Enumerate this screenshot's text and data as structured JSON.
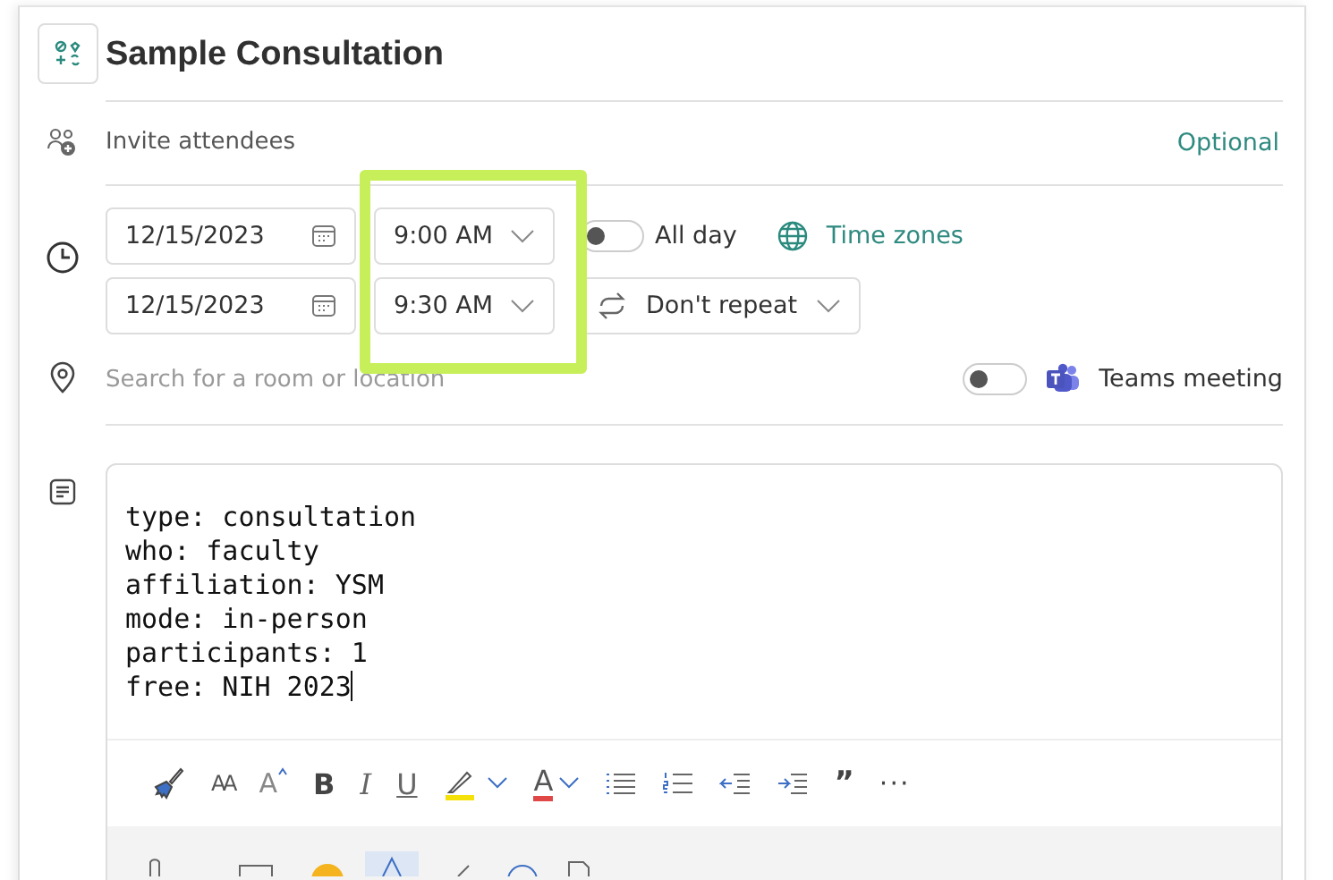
{
  "event": {
    "title": "Sample Consultation"
  },
  "attendees": {
    "placeholder": "Invite attendees",
    "optional_link": "Optional"
  },
  "start": {
    "date": "12/15/2023",
    "time": "9:00 AM"
  },
  "end": {
    "date": "12/15/2023",
    "time": "9:30 AM"
  },
  "all_day": {
    "label": "All day",
    "on": false
  },
  "time_zones": "Time zones",
  "repeat": "Don't repeat",
  "location": {
    "placeholder": "Search for a room or location"
  },
  "teams_meeting": {
    "label": "Teams meeting",
    "on": false
  },
  "body": {
    "lines": [
      "type: consultation",
      "who: faculty",
      "affiliation: YSM",
      "mode: in-person",
      "participants: 1",
      "free: NIH 2023"
    ]
  },
  "toolbar": [
    {
      "kind": "icon"
    },
    {
      "kind": "glyph",
      "label": "AA"
    },
    {
      "kind": "glyph",
      "label": "A"
    },
    {
      "kind": "glyph",
      "label": "B"
    },
    {
      "kind": "glyph",
      "label": "I"
    },
    {
      "kind": "glyph",
      "label": "U"
    },
    {
      "kind": "icon"
    },
    {
      "kind": "glyph",
      "label": "A"
    },
    {
      "kind": "icon"
    },
    {
      "kind": "icon"
    },
    {
      "kind": "icon"
    },
    {
      "kind": "icon"
    },
    {
      "kind": "glyph",
      "label": "”"
    },
    {
      "kind": "glyph",
      "label": "···"
    }
  ]
}
